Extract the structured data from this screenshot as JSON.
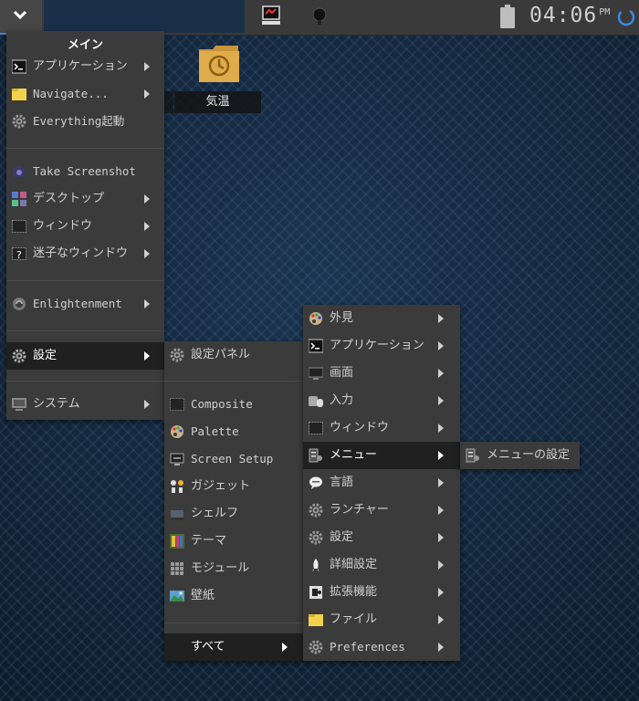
{
  "shelf": {
    "clock_time": "04:06",
    "clock_ampm": "PM"
  },
  "desktop": {
    "icon_label": "気温"
  },
  "main_menu": {
    "title": "メイン",
    "items": [
      {
        "label": "アプリケーション"
      },
      {
        "label": "Navigate..."
      },
      {
        "label": "Everything起動"
      },
      {
        "label": "Take Screenshot"
      },
      {
        "label": "デスクトップ"
      },
      {
        "label": "ウィンドウ"
      },
      {
        "label": "迷子なウィンドウ"
      },
      {
        "label": "Enlightenment"
      },
      {
        "label": "設定"
      },
      {
        "label": "システム"
      }
    ]
  },
  "settings_menu": {
    "items": [
      {
        "label": "設定パネル"
      },
      {
        "label": "Composite"
      },
      {
        "label": "Palette"
      },
      {
        "label": "Screen Setup"
      },
      {
        "label": "ガジェット"
      },
      {
        "label": "シェルフ"
      },
      {
        "label": "テーマ"
      },
      {
        "label": "モジュール"
      },
      {
        "label": "壁紙"
      },
      {
        "label": "すべて"
      }
    ]
  },
  "all_menu": {
    "items": [
      {
        "label": "外見"
      },
      {
        "label": "アプリケーション"
      },
      {
        "label": "画面"
      },
      {
        "label": "入力"
      },
      {
        "label": "ウィンドウ"
      },
      {
        "label": "メニュー"
      },
      {
        "label": "言語"
      },
      {
        "label": "ランチャー"
      },
      {
        "label": "設定"
      },
      {
        "label": "詳細設定"
      },
      {
        "label": "拡張機能"
      },
      {
        "label": "ファイル"
      },
      {
        "label": "Preferences"
      }
    ]
  },
  "menu_submenu": {
    "items": [
      {
        "label": "メニューの設定"
      }
    ]
  }
}
